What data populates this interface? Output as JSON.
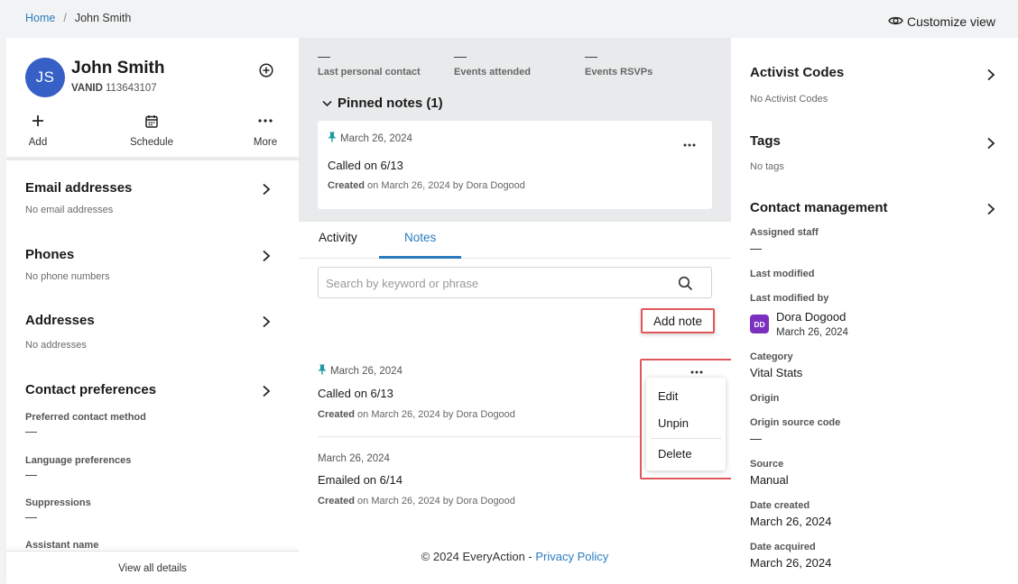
{
  "breadcrumb": {
    "home": "Home",
    "separator": "/",
    "current": "John Smith"
  },
  "header": {
    "customize_label": "Customize view",
    "customize_icon": "eye-icon"
  },
  "profile": {
    "initials": "JS",
    "name": "John Smith",
    "vanid_label": "VANID",
    "vanid": "113643107",
    "avatar_color": "#3660c6"
  },
  "actions": [
    {
      "label": "Add",
      "icon": "plus-icon"
    },
    {
      "label": "Schedule",
      "icon": "calendar-icon"
    },
    {
      "label": "More",
      "icon": "more-horizontal-icon"
    }
  ],
  "left_sections": {
    "email": {
      "title": "Email addresses",
      "empty": "No email addresses"
    },
    "phones": {
      "title": "Phones",
      "empty": "No phone numbers"
    },
    "addresses": {
      "title": "Addresses",
      "empty": "No addresses"
    },
    "contact_prefs": {
      "title": "Contact preferences",
      "fields": [
        {
          "label": "Preferred contact method",
          "value": "—"
        },
        {
          "label": "Language preferences",
          "value": "—"
        },
        {
          "label": "Suppressions",
          "value": "—"
        },
        {
          "label": "Assistant name",
          "value": ""
        }
      ]
    }
  },
  "view_all_label": "View all details",
  "stats": [
    {
      "value": "—",
      "label": "Last personal contact"
    },
    {
      "value": "—",
      "label": "Events attended"
    },
    {
      "value": "—",
      "label": "Events RSVPs"
    }
  ],
  "pinned": {
    "title": "Pinned notes (1)",
    "card": {
      "date": "March 26, 2024",
      "text": "Called on 6/13",
      "created_label": "Created",
      "created_rest": " on March 26, 2024 by Dora Dogood"
    }
  },
  "tabs": [
    {
      "label": "Activity",
      "active": false
    },
    {
      "label": "Notes",
      "active": true
    }
  ],
  "search": {
    "placeholder": "Search by keyword or phrase"
  },
  "add_note_label": "Add note",
  "notes": [
    {
      "date": "March 26, 2024",
      "pinned": true,
      "text": "Called on 6/13",
      "created_label": "Created",
      "created_rest": " on March 26, 2024 by Dora Dogood"
    },
    {
      "date": "March 26, 2024",
      "pinned": false,
      "text": "Emailed on 6/14",
      "created_label": "Created",
      "created_rest": " on March 26, 2024 by Dora Dogood"
    }
  ],
  "note_menu": {
    "items": [
      "Edit",
      "Unpin",
      "Delete"
    ]
  },
  "footer": {
    "copyright": "© 2024 EveryAction - ",
    "privacy": "Privacy Policy"
  },
  "right": {
    "activist_codes": {
      "title": "Activist Codes",
      "empty": "No Activist Codes"
    },
    "tags": {
      "title": "Tags",
      "empty": "No tags"
    },
    "contact_mgmt": {
      "title": "Contact management",
      "assigned_staff_label": "Assigned staff",
      "assigned_staff_value": "—",
      "last_modified_label": "Last modified",
      "last_modified_by_label": "Last modified by",
      "modifier_initials": "DD",
      "modifier_name": "Dora Dogood",
      "modifier_date": "March 26, 2024",
      "category_label": "Category",
      "category_value": "Vital Stats",
      "origin_label": "Origin",
      "origin_code_label": "Origin source code",
      "origin_code_value": "—",
      "source_label": "Source",
      "source_value": "Manual",
      "date_created_label": "Date created",
      "date_created_value": "March 26, 2024",
      "date_acquired_label": "Date acquired",
      "date_acquired_value": "March 26, 2024"
    }
  },
  "colors": {
    "link": "#2b7bbf",
    "highlight": "#e0575b",
    "pin": "#1a9aa0",
    "modifier_avatar": "#7a2fbf"
  }
}
